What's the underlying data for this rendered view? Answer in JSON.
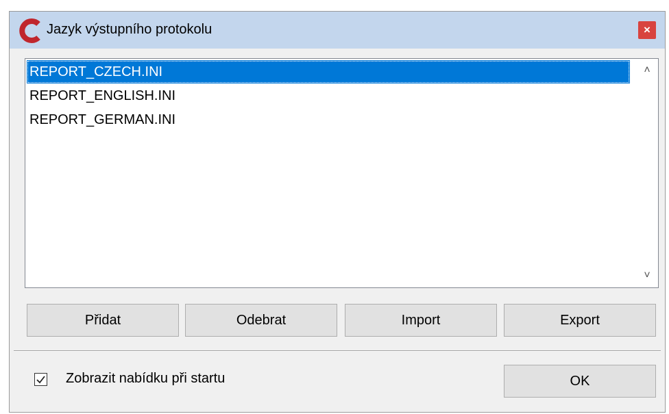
{
  "window": {
    "title": "Jazyk výstupního protokolu",
    "close_glyph": "×",
    "app_icon": "red-c-logo-icon"
  },
  "list": {
    "items": [
      {
        "label": "REPORT_CZECH.INI",
        "selected": true
      },
      {
        "label": "REPORT_ENGLISH.INI",
        "selected": false
      },
      {
        "label": "REPORT_GERMAN.INI",
        "selected": false
      }
    ],
    "scroll_up_glyph": "˄",
    "scroll_down_glyph": "˅"
  },
  "buttons": {
    "add": "Přidat",
    "remove": "Odebrat",
    "import": "Import",
    "export": "Export",
    "ok": "OK"
  },
  "startup_checkbox": {
    "label": "Zobrazit nabídku při startu",
    "checked": true
  },
  "colors": {
    "titlebar": "#c3d6ed",
    "selection": "#0078d7",
    "close": "#d8433f",
    "logo": "#c0262d"
  }
}
